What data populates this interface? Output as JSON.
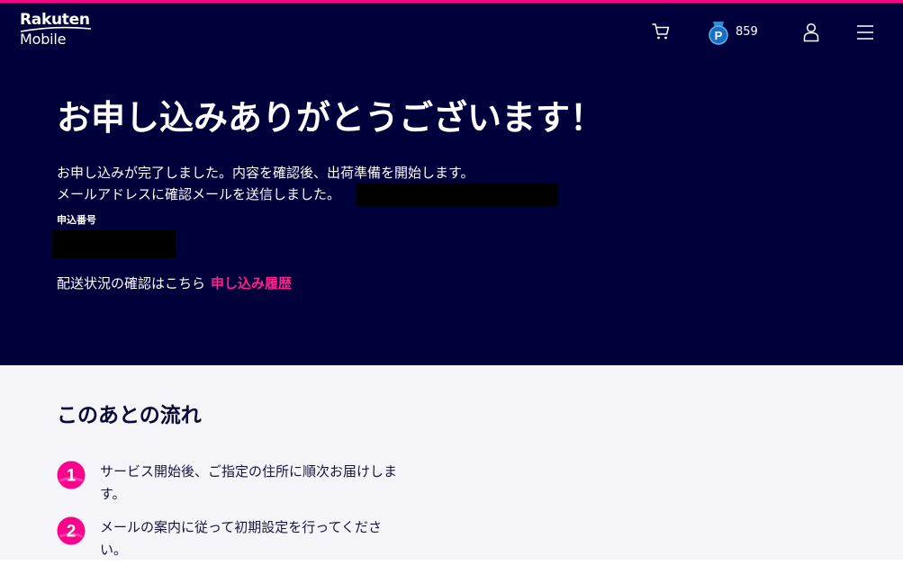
{
  "header": {
    "logo_brand": "Rakuten",
    "logo_product": "Mobile",
    "points": "859",
    "icons": {
      "cart": "cart-icon",
      "points": "points-badge-icon",
      "points_letter": "P",
      "account": "user-icon",
      "menu": "menu-icon"
    }
  },
  "hero": {
    "title": "お申し込みありがとうございます！",
    "message_1": "お申し込みが完了しました。内容を確認後、出荷準備を開始します。",
    "message_2": "メールアドレスに確認メールを送信しました。",
    "order_number_label": "申込番号",
    "status_text": "配送状況の確認はこちら",
    "history_link": "申し込み履歴"
  },
  "flow": {
    "title": "このあとの流れ",
    "steps": [
      {
        "number": "1",
        "text": "サービス開始後、ご指定の住所に順次お届けします。"
      },
      {
        "number": "2",
        "text": "メールの案内に従って初期設定を行ってください。"
      }
    ]
  },
  "colors": {
    "accent": "#ff008c",
    "hero_bg": "#00003a",
    "link": "#ff1e8c",
    "lower_bg": "#f4f4f9"
  }
}
